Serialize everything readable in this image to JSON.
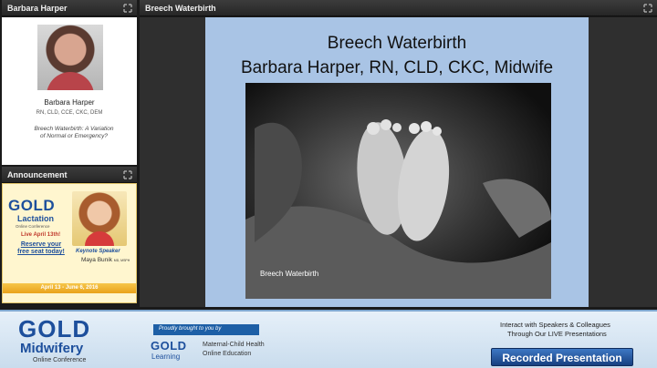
{
  "speaker_panel": {
    "header": "Barbara Harper",
    "name": "Barbara Harper",
    "credentials": "RN, CLD, CCE, CKC, DEM",
    "talk_line1": "Breech Waterbirth: A Variation",
    "talk_line2": "of Normal or Emergency?"
  },
  "slide_panel": {
    "header": "Breech Waterbirth"
  },
  "announcement_panel": {
    "header": "Announcement",
    "gold": "GOLD",
    "lactation": "Lactation",
    "online_conference": "Online Conference",
    "live_date": "Live April 13th!",
    "reserve_line1": "Reserve your",
    "reserve_line2": "free seat today!",
    "keynote_label": "Keynote Speaker",
    "keynote_name": "Maya Bunik",
    "keynote_creds": "MD, MSPH",
    "date_range": "April 13 - June 6, 2016"
  },
  "slide": {
    "title": "Breech Waterbirth",
    "subtitle": "Barbara Harper, RN, CLD, CKC, Midwife",
    "photo_caption": "Breech Waterbirth"
  },
  "footer": {
    "gold": "GOLD",
    "midwifery": "Midwifery",
    "online_conference": "Online Conference",
    "brought_to_you": "Proudly brought to you by",
    "gold_learning_gold": "GOLD",
    "gold_learning_learning": "Learning",
    "learning_sub1": "Maternal-Child Health",
    "learning_sub2": "Online Education",
    "interact_line1": "Interact with Speakers & Colleagues",
    "interact_line2": "Through Our LIVE Presentations",
    "recorded_button": "Recorded Presentation"
  },
  "colors": {
    "brand_blue": "#1d4f9c",
    "gold": "#e8a317",
    "slide_bg": "#a9c4e5"
  }
}
